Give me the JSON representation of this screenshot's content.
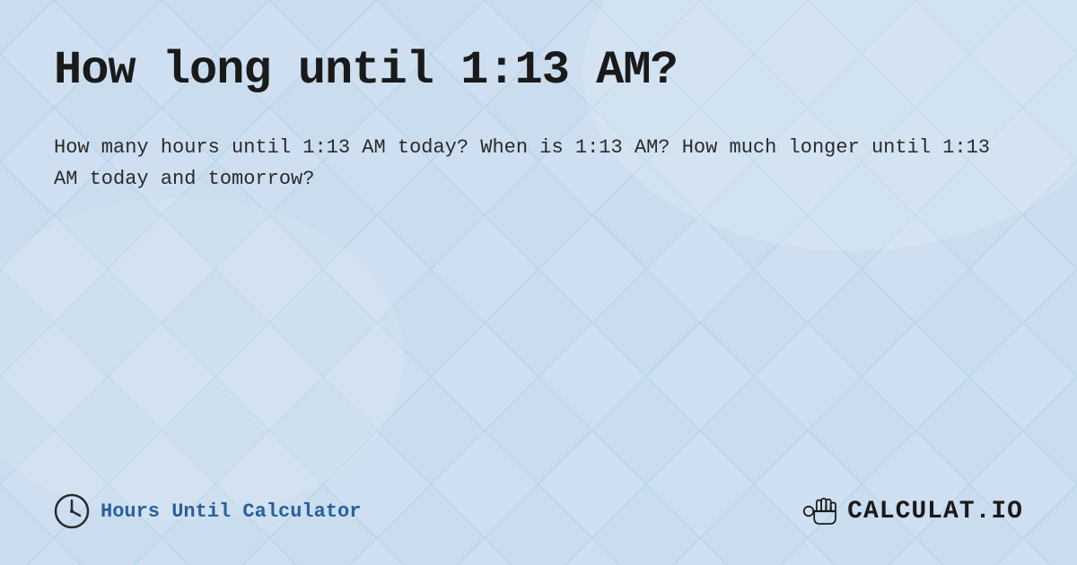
{
  "page": {
    "title": "How long until 1:13 AM?",
    "description": "How many hours until 1:13 AM today? When is 1:13 AM? How much longer until 1:13 AM today and tomorrow?",
    "background_color": "#b8d0e8"
  },
  "footer": {
    "brand_left_label": "Hours Until Calculator",
    "brand_right_label": "CALCULAT.IO",
    "clock_icon": "clock-icon",
    "calc_icon": "calculator-icon"
  }
}
